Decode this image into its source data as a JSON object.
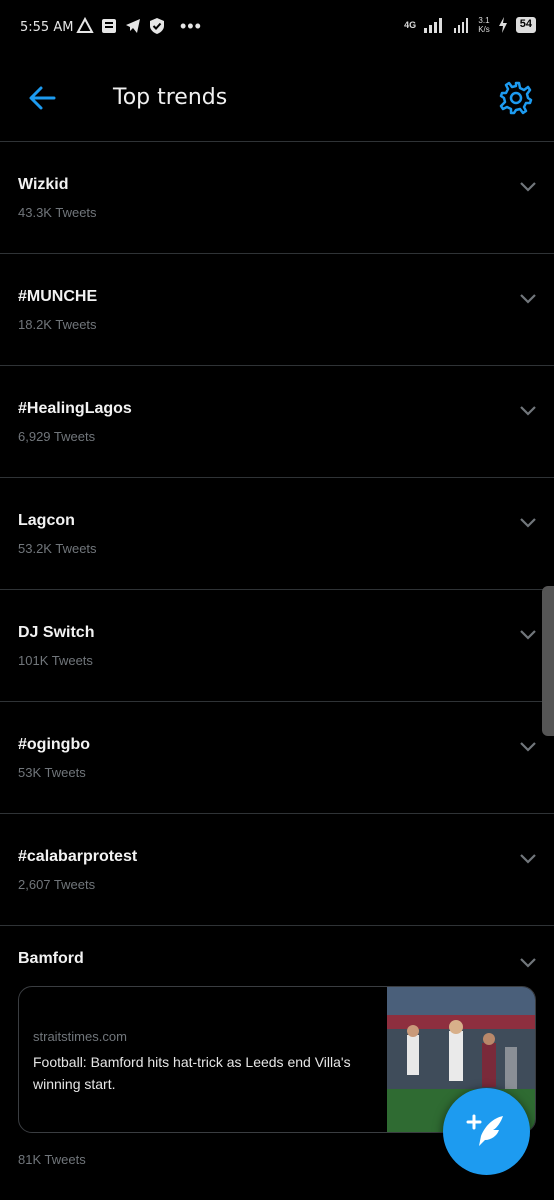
{
  "status_bar": {
    "time": "5:55 AM",
    "dots": "•••",
    "network": "4G",
    "speed": "3.1\nK/s",
    "battery": "54"
  },
  "header": {
    "title": "Top trends"
  },
  "trends": [
    {
      "name": "Wizkid",
      "count": "43.3K Tweets"
    },
    {
      "name": "#MUNCHE",
      "count": "18.2K Tweets"
    },
    {
      "name": "#HealingLagos",
      "count": "6,929 Tweets"
    },
    {
      "name": "Lagcon",
      "count": "53.2K Tweets"
    },
    {
      "name": "DJ Switch",
      "count": "101K Tweets"
    },
    {
      "name": "#ogingbo",
      "count": "53K Tweets"
    },
    {
      "name": "#calabarprotest",
      "count": "2,607 Tweets"
    }
  ],
  "featured_trend": {
    "name": "Bamford",
    "count": "81K Tweets",
    "card": {
      "source": "straitstimes.com",
      "headline": "Football: Bamford hits hat-trick as Leeds end Villa's winning start."
    }
  },
  "icons": {
    "back": "back-arrow-icon",
    "settings": "gear-icon",
    "chevron": "chevron-down-icon",
    "compose": "compose-tweet-icon"
  },
  "colors": {
    "accent": "#1d9bf0",
    "background": "#000000",
    "divider": "#2f3336",
    "muted": "#71767b"
  }
}
